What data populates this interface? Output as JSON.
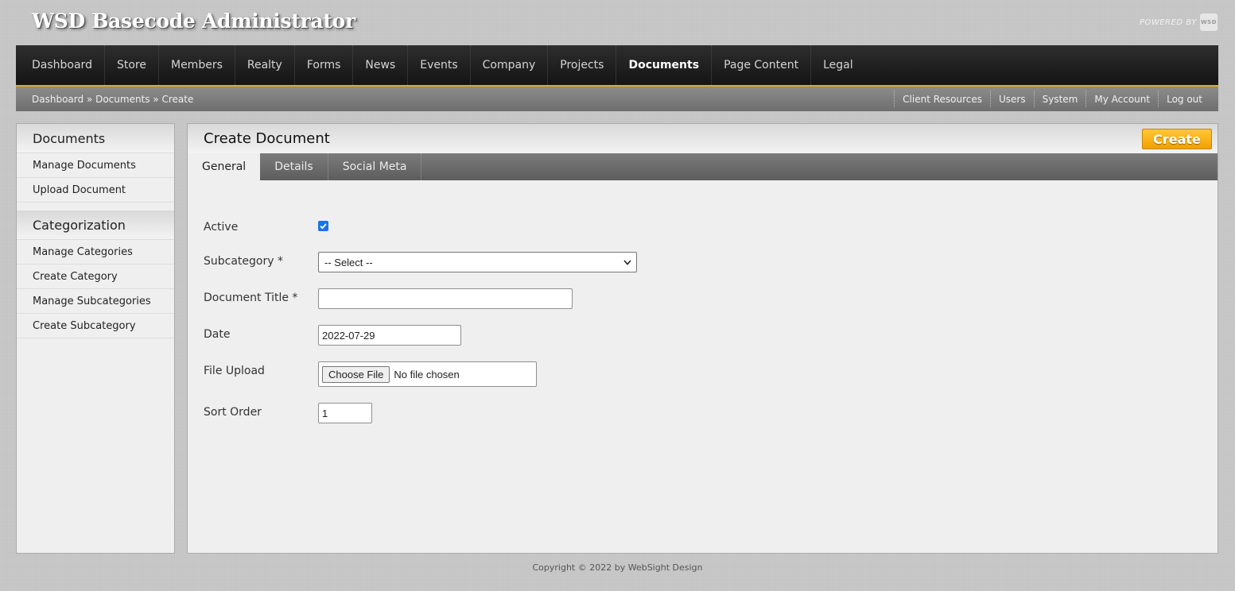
{
  "header": {
    "title": "WSD Basecode Administrator",
    "powered_by": "POWERED BY",
    "logo_text": "WSD"
  },
  "nav": {
    "items": [
      {
        "label": "Dashboard"
      },
      {
        "label": "Store"
      },
      {
        "label": "Members"
      },
      {
        "label": "Realty"
      },
      {
        "label": "Forms"
      },
      {
        "label": "News"
      },
      {
        "label": "Events"
      },
      {
        "label": "Company"
      },
      {
        "label": "Projects"
      },
      {
        "label": "Documents",
        "active": true
      },
      {
        "label": "Page Content"
      },
      {
        "label": "Legal"
      }
    ],
    "accent_color": "#e8a61c"
  },
  "breadcrumb": {
    "items": [
      "Dashboard",
      "Documents",
      "Create"
    ],
    "separator": "»"
  },
  "utility_links": [
    "Client Resources",
    "Users",
    "System",
    "My Account",
    "Log out"
  ],
  "sidebar": {
    "sections": [
      {
        "title": "Documents",
        "items": [
          "Manage Documents",
          "Upload Document"
        ]
      },
      {
        "title": "Categorization",
        "items": [
          "Manage Categories",
          "Create Category",
          "Manage Subcategories",
          "Create Subcategory"
        ]
      }
    ]
  },
  "main": {
    "title": "Create Document",
    "create_button": "Create",
    "tabs": [
      {
        "label": "General",
        "active": true
      },
      {
        "label": "Details"
      },
      {
        "label": "Social Meta"
      }
    ]
  },
  "form": {
    "active_label": "Active",
    "active_checked": true,
    "subcategory_label": "Subcategory *",
    "subcategory_value": "-- Select --",
    "title_label": "Document Title *",
    "title_value": "",
    "date_label": "Date",
    "date_value": "2022-07-29",
    "file_label": "File Upload",
    "file_button": "Choose File",
    "file_status": "No file chosen",
    "sort_label": "Sort Order",
    "sort_value": "1"
  },
  "footer": {
    "copyright": "Copyright © 2022 by WebSight Design"
  }
}
